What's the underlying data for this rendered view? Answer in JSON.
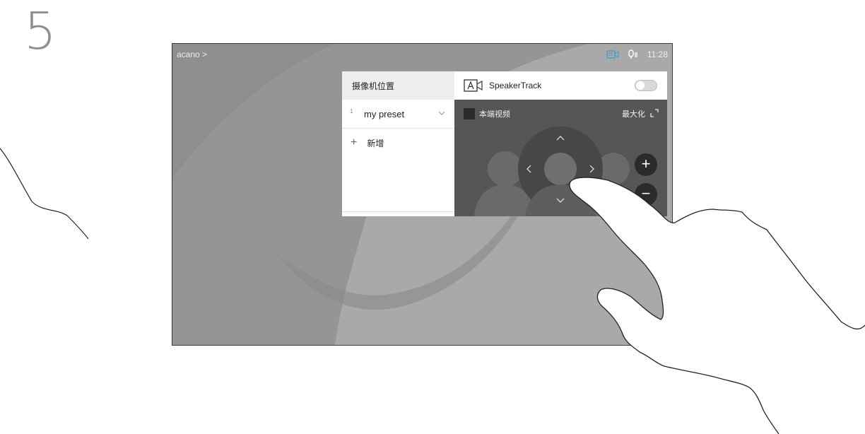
{
  "step": {
    "number": "5"
  },
  "topbar": {
    "left_label": "acano >",
    "time": "11:28",
    "icons": [
      "camera-share-icon",
      "microphone-icon"
    ]
  },
  "presets": {
    "header": "摄像机位置",
    "items": [
      {
        "index": "1",
        "name": "my preset"
      }
    ],
    "add_label": "新增"
  },
  "camera": {
    "speakertrack_label": "SpeakerTrack",
    "speakertrack_enabled": false,
    "selfview_label": "本端视频",
    "maximize_label": "最大化",
    "zoom_in": "+",
    "zoom_out": "−"
  },
  "colors": {
    "accent": "#4a9ec8",
    "panel_dark": "#555555",
    "background": "#9a9a9a"
  }
}
